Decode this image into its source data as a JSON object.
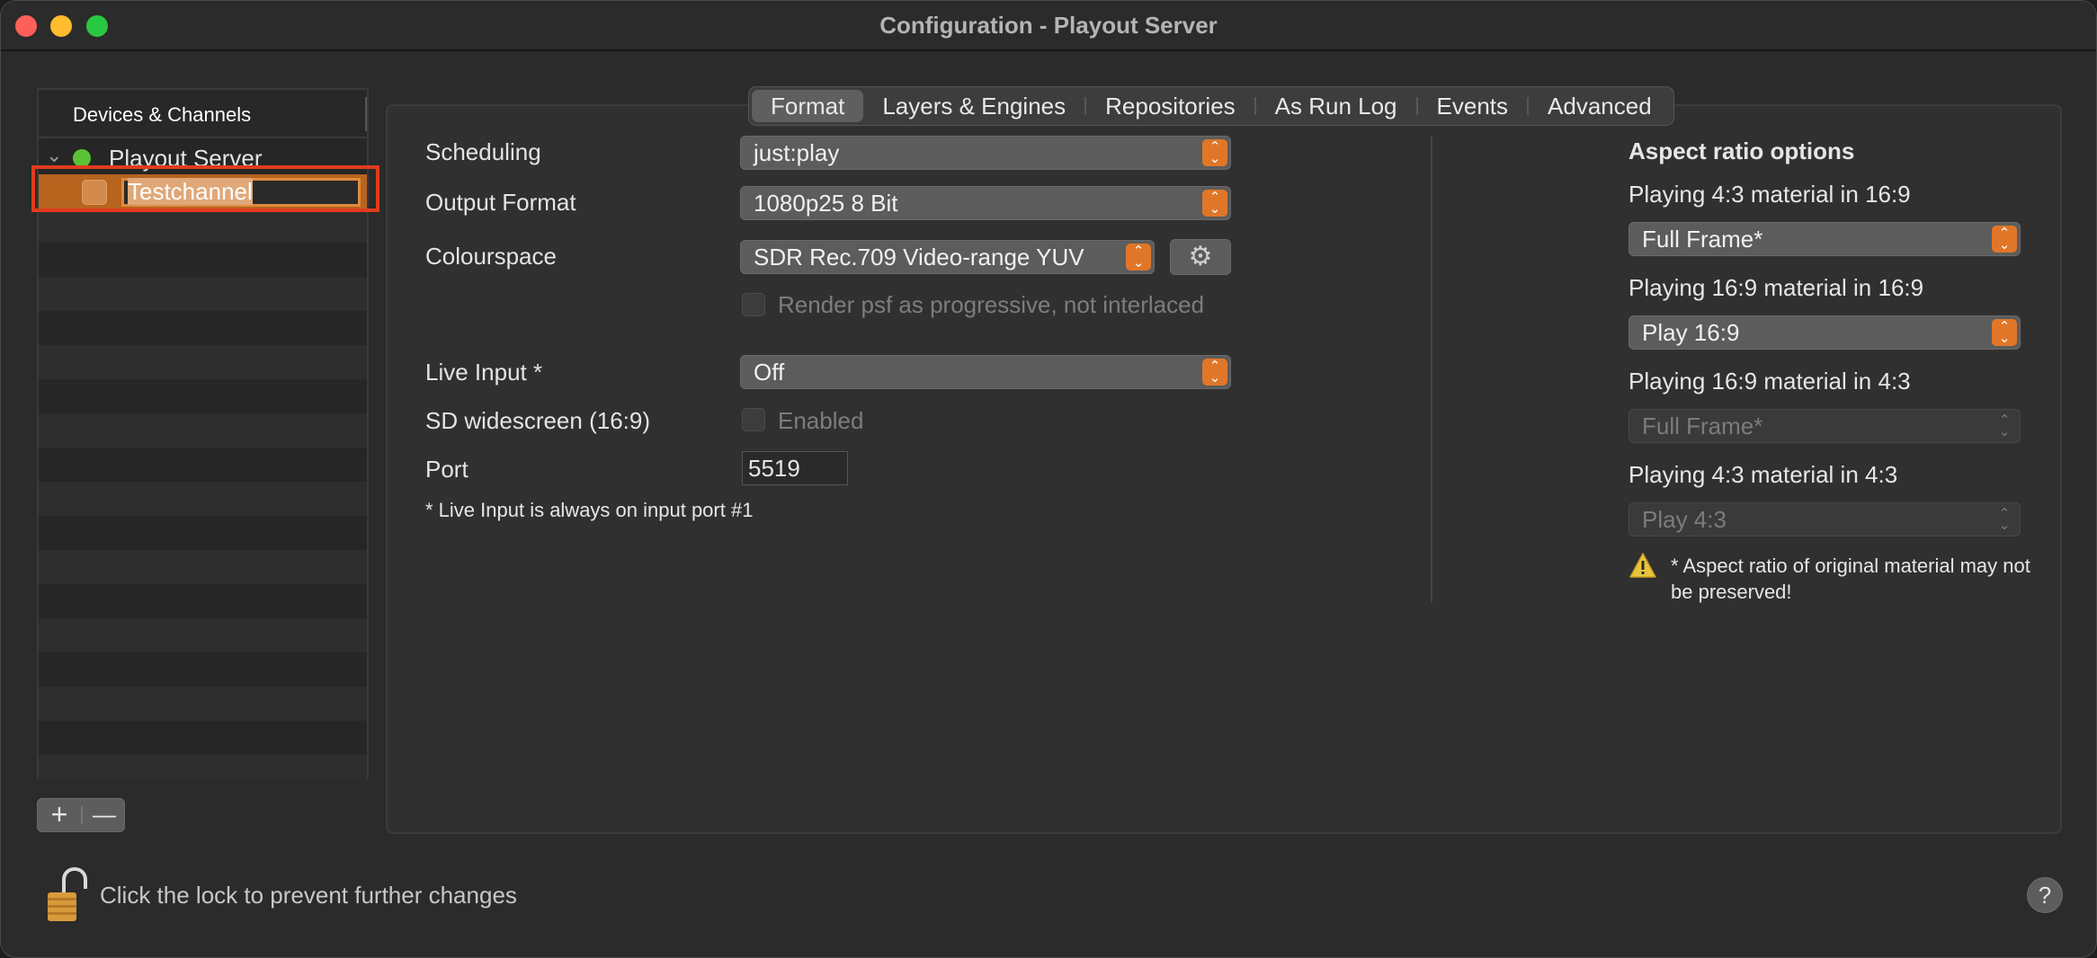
{
  "window": {
    "title": "Configuration - Playout Server"
  },
  "sidebar": {
    "header": "Devices & Channels",
    "server": {
      "name": "Playout Server",
      "status_color": "#5bc236"
    },
    "channel": {
      "name": "Testchannel"
    },
    "add_label": "+",
    "remove_label": "—"
  },
  "tabs": [
    {
      "label": "Format",
      "active": true
    },
    {
      "label": "Layers & Engines"
    },
    {
      "label": "Repositories"
    },
    {
      "label": "As Run Log"
    },
    {
      "label": "Events"
    },
    {
      "label": "Advanced"
    }
  ],
  "format": {
    "scheduling": {
      "label": "Scheduling",
      "value": "just:play"
    },
    "output_format": {
      "label": "Output Format",
      "value": "1080p25 8 Bit"
    },
    "colourspace": {
      "label": "Colourspace",
      "value": "SDR Rec.709 Video-range YUV"
    },
    "render_psf": {
      "label": "Render psf as progressive, not interlaced",
      "checked": false
    },
    "live_input": {
      "label": "Live Input *",
      "value": "Off"
    },
    "sd_widescreen": {
      "label": "SD widescreen (16:9)",
      "checkbox_label": "Enabled",
      "checked": false
    },
    "port": {
      "label": "Port",
      "value": "5519"
    },
    "note": "* Live Input is always on input port #1"
  },
  "aspect": {
    "title": "Aspect ratio options",
    "options": [
      {
        "label": "Playing 4:3 material in 16:9",
        "value": "Full Frame*",
        "enabled": true
      },
      {
        "label": "Playing 16:9 material in 16:9",
        "value": "Play 16:9",
        "enabled": true
      },
      {
        "label": "Playing 16:9 material in 4:3",
        "value": "Full Frame*",
        "enabled": false
      },
      {
        "label": "Playing 4:3 material in 4:3",
        "value": "Play 4:3",
        "enabled": false
      }
    ],
    "warning": "* Aspect ratio of original material may not be preserved!"
  },
  "footer": {
    "lock_text": "Click the lock to prevent further changes",
    "help_label": "?"
  },
  "colors": {
    "accent": "#e07728",
    "selection": "#b7641f",
    "annotation": "#e23b1d"
  },
  "icons": [
    "lock-open-icon",
    "gear-icon",
    "warning-icon",
    "chevron-down-icon",
    "stepper-icon"
  ]
}
